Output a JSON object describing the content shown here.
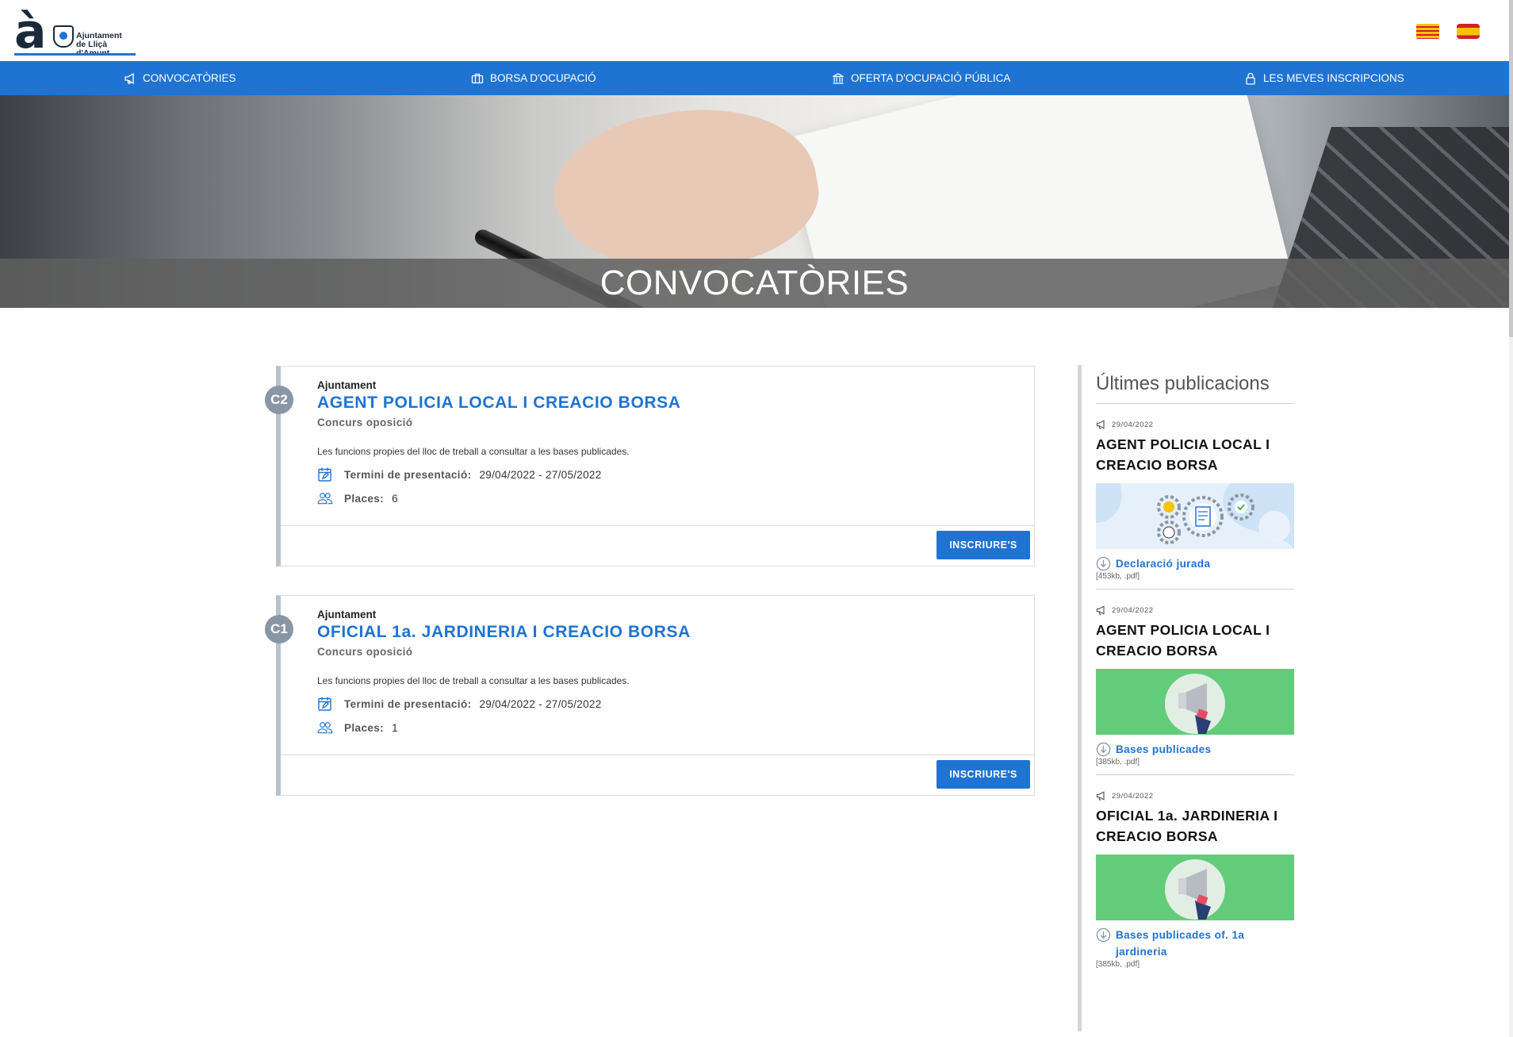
{
  "brand": {
    "name_line1": "Ajuntament",
    "name_line2": "de Lliçà d'Amunt"
  },
  "languages": [
    {
      "code": "ca",
      "icon": "catalan-flag-icon"
    },
    {
      "code": "es",
      "icon": "spanish-flag-icon"
    }
  ],
  "nav": [
    {
      "label": "CONVOCATÒRIES",
      "icon": "megaphone-icon"
    },
    {
      "label": "BORSA D'OCUPACIÓ",
      "icon": "briefcase-icon"
    },
    {
      "label": "OFERTA D'OCUPACIÓ PÚBLICA",
      "icon": "institution-icon"
    },
    {
      "label": "LES MEVES INSCRIPCIONS",
      "icon": "lock-icon"
    }
  ],
  "hero": {
    "title": "CONVOCATÒRIES"
  },
  "convocatories": [
    {
      "badge": "C2",
      "org": "Ajuntament",
      "title": "AGENT POLICIA LOCAL I CREACIO BORSA",
      "type": "Concurs oposició",
      "description": "Les funcions propies del lloc de treball a consultar a les bases publicades.",
      "deadline_label": "Termini de presentació:",
      "deadline": "29/04/2022 - 27/05/2022",
      "places_label": "Places:",
      "places": "6",
      "button": "INSCRIURE'S"
    },
    {
      "badge": "C1",
      "org": "Ajuntament",
      "title": "OFICIAL 1a. JARDINERIA I CREACIO BORSA",
      "type": "Concurs oposició",
      "description": "Les funcions propies del lloc de treball a consultar a les bases publicades.",
      "deadline_label": "Termini de presentació:",
      "deadline": "29/04/2022 - 27/05/2022",
      "places_label": "Places:",
      "places": "1",
      "button": "INSCRIURE'S"
    }
  ],
  "sidebar": {
    "heading": "Últimes publicacions",
    "items": [
      {
        "date": "29/04/2022",
        "title": "AGENT POLICIA LOCAL I CREACIO BORSA",
        "thumb": "gears-document-illustration",
        "file": "Declaració jurada",
        "size": "[453kb, .pdf]"
      },
      {
        "date": "29/04/2022",
        "title": "AGENT POLICIA LOCAL I CREACIO BORSA",
        "thumb": "megaphone-illustration",
        "file": "Bases publicades",
        "size": "[385kb, .pdf]"
      },
      {
        "date": "29/04/2022",
        "title": "OFICIAL 1a. JARDINERIA I CREACIO BORSA",
        "thumb": "megaphone-illustration",
        "file": "Bases publicades of. 1a jardineria",
        "size": "[385kb, .pdf]"
      }
    ]
  },
  "colors": {
    "primary": "#1f73d2",
    "badge": "#8a96a3",
    "card_border": "#b8c2cc",
    "green_thumb": "#62cc7a",
    "blue_thumb": "#cfe3f7"
  }
}
